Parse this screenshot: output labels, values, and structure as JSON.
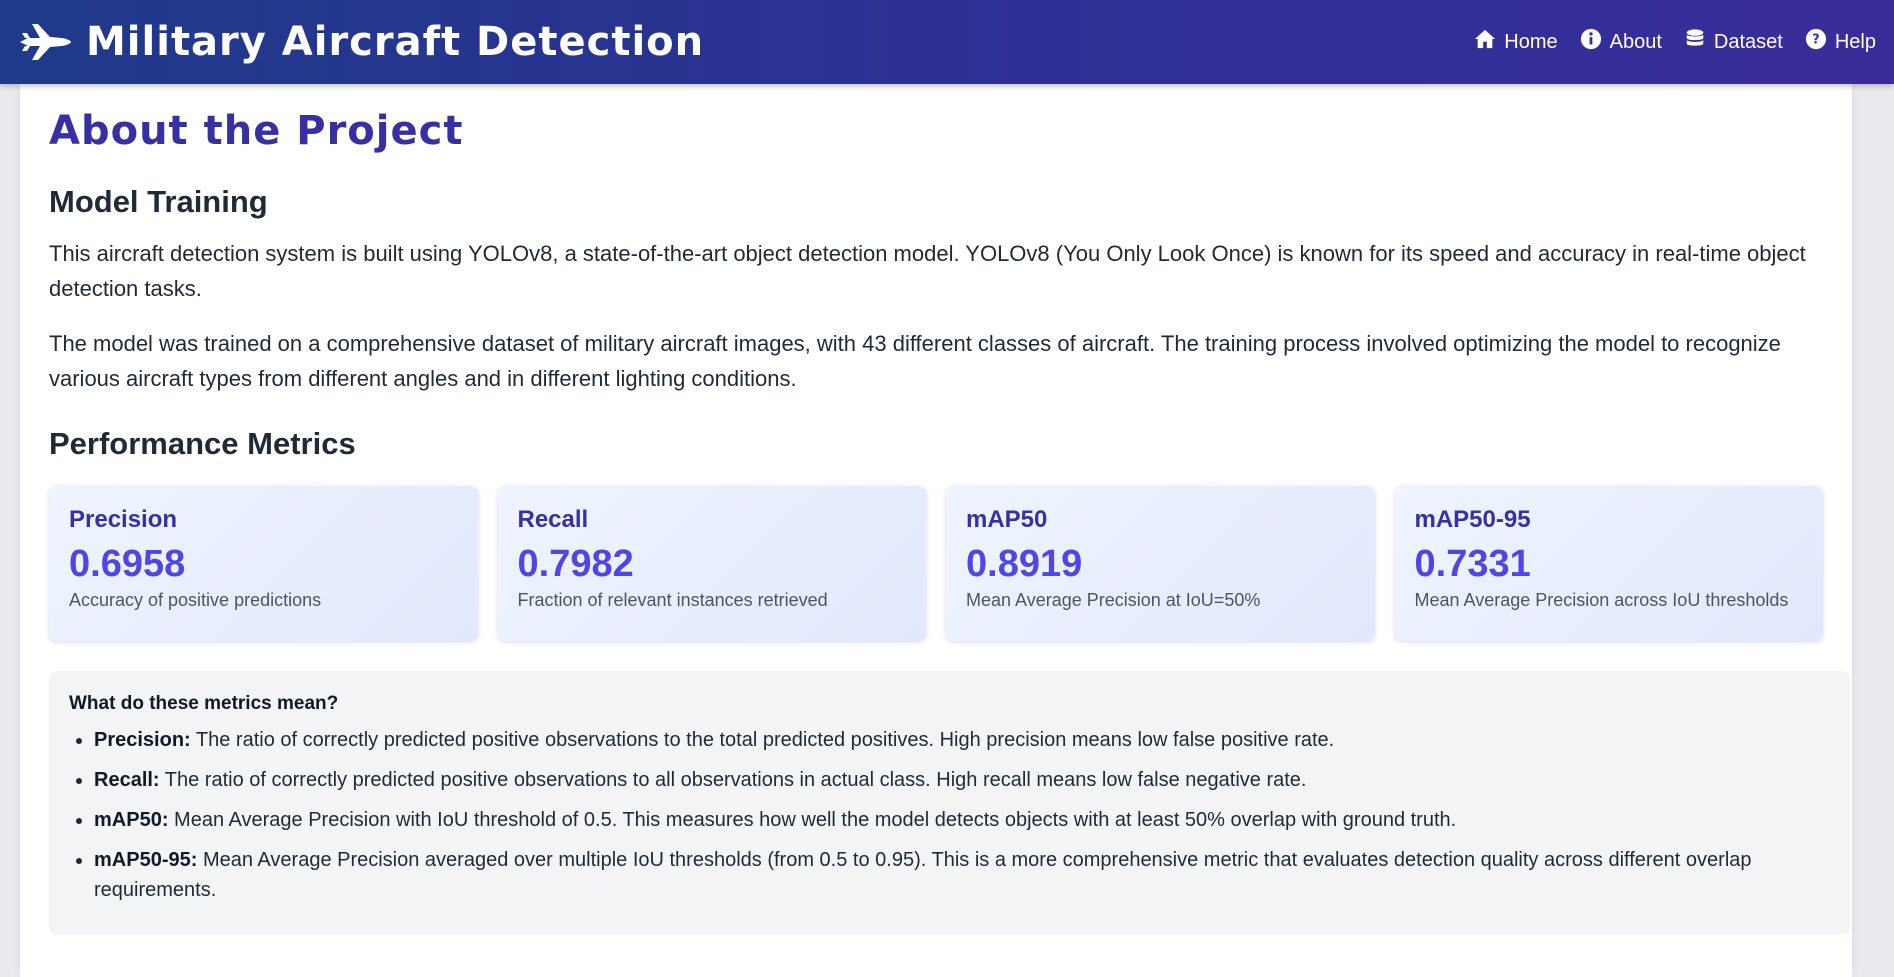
{
  "header": {
    "app_title": "Military Aircraft Detection",
    "logo_icon": "fighter-jet-icon",
    "nav": [
      {
        "label": "Home",
        "icon": "home-icon"
      },
      {
        "label": "About",
        "icon": "info-icon"
      },
      {
        "label": "Dataset",
        "icon": "database-icon"
      },
      {
        "label": "Help",
        "icon": "question-icon"
      }
    ]
  },
  "page": {
    "title": "About the Project",
    "training": {
      "heading": "Model Training",
      "paragraphs": [
        "This aircraft detection system is built using YOLOv8, a state-of-the-art object detection model. YOLOv8 (You Only Look Once) is known for its speed and accuracy in real-time object detection tasks.",
        "The model was trained on a comprehensive dataset of military aircraft images, with 43 different classes of aircraft. The training process involved optimizing the model to recognize various aircraft types from different angles and in different lighting conditions."
      ]
    },
    "metrics": {
      "heading": "Performance Metrics",
      "cards": [
        {
          "name": "Precision",
          "value": "0.6958",
          "desc": "Accuracy of positive predictions"
        },
        {
          "name": "Recall",
          "value": "0.7982",
          "desc": "Fraction of relevant instances retrieved"
        },
        {
          "name": "mAP50",
          "value": "0.8919",
          "desc": "Mean Average Precision at IoU=50%"
        },
        {
          "name": "mAP50-95",
          "value": "0.7331",
          "desc": "Mean Average Precision across IoU thresholds"
        }
      ]
    },
    "explanation": {
      "title": "What do these metrics mean?",
      "items": [
        {
          "term": "Precision:",
          "text": " The ratio of correctly predicted positive observations to the total predicted positives. High precision means low false positive rate."
        },
        {
          "term": "Recall:",
          "text": " The ratio of correctly predicted positive observations to all observations in actual class. High recall means low false negative rate."
        },
        {
          "term": "mAP50:",
          "text": " Mean Average Precision with IoU threshold of 0.5. This measures how well the model detects objects with at least 50% overlap with ground truth."
        },
        {
          "term": "mAP50-95:",
          "text": " Mean Average Precision averaged over multiple IoU thresholds (from 0.5 to 0.95). This is a more comprehensive metric that evaluates detection quality across different overlap requirements."
        }
      ]
    }
  },
  "colors": {
    "navbar_start": "#1e3a8a",
    "navbar_end": "#3a2d9a",
    "title_accent": "#3730a3",
    "metric_value": "#4f46e5"
  }
}
